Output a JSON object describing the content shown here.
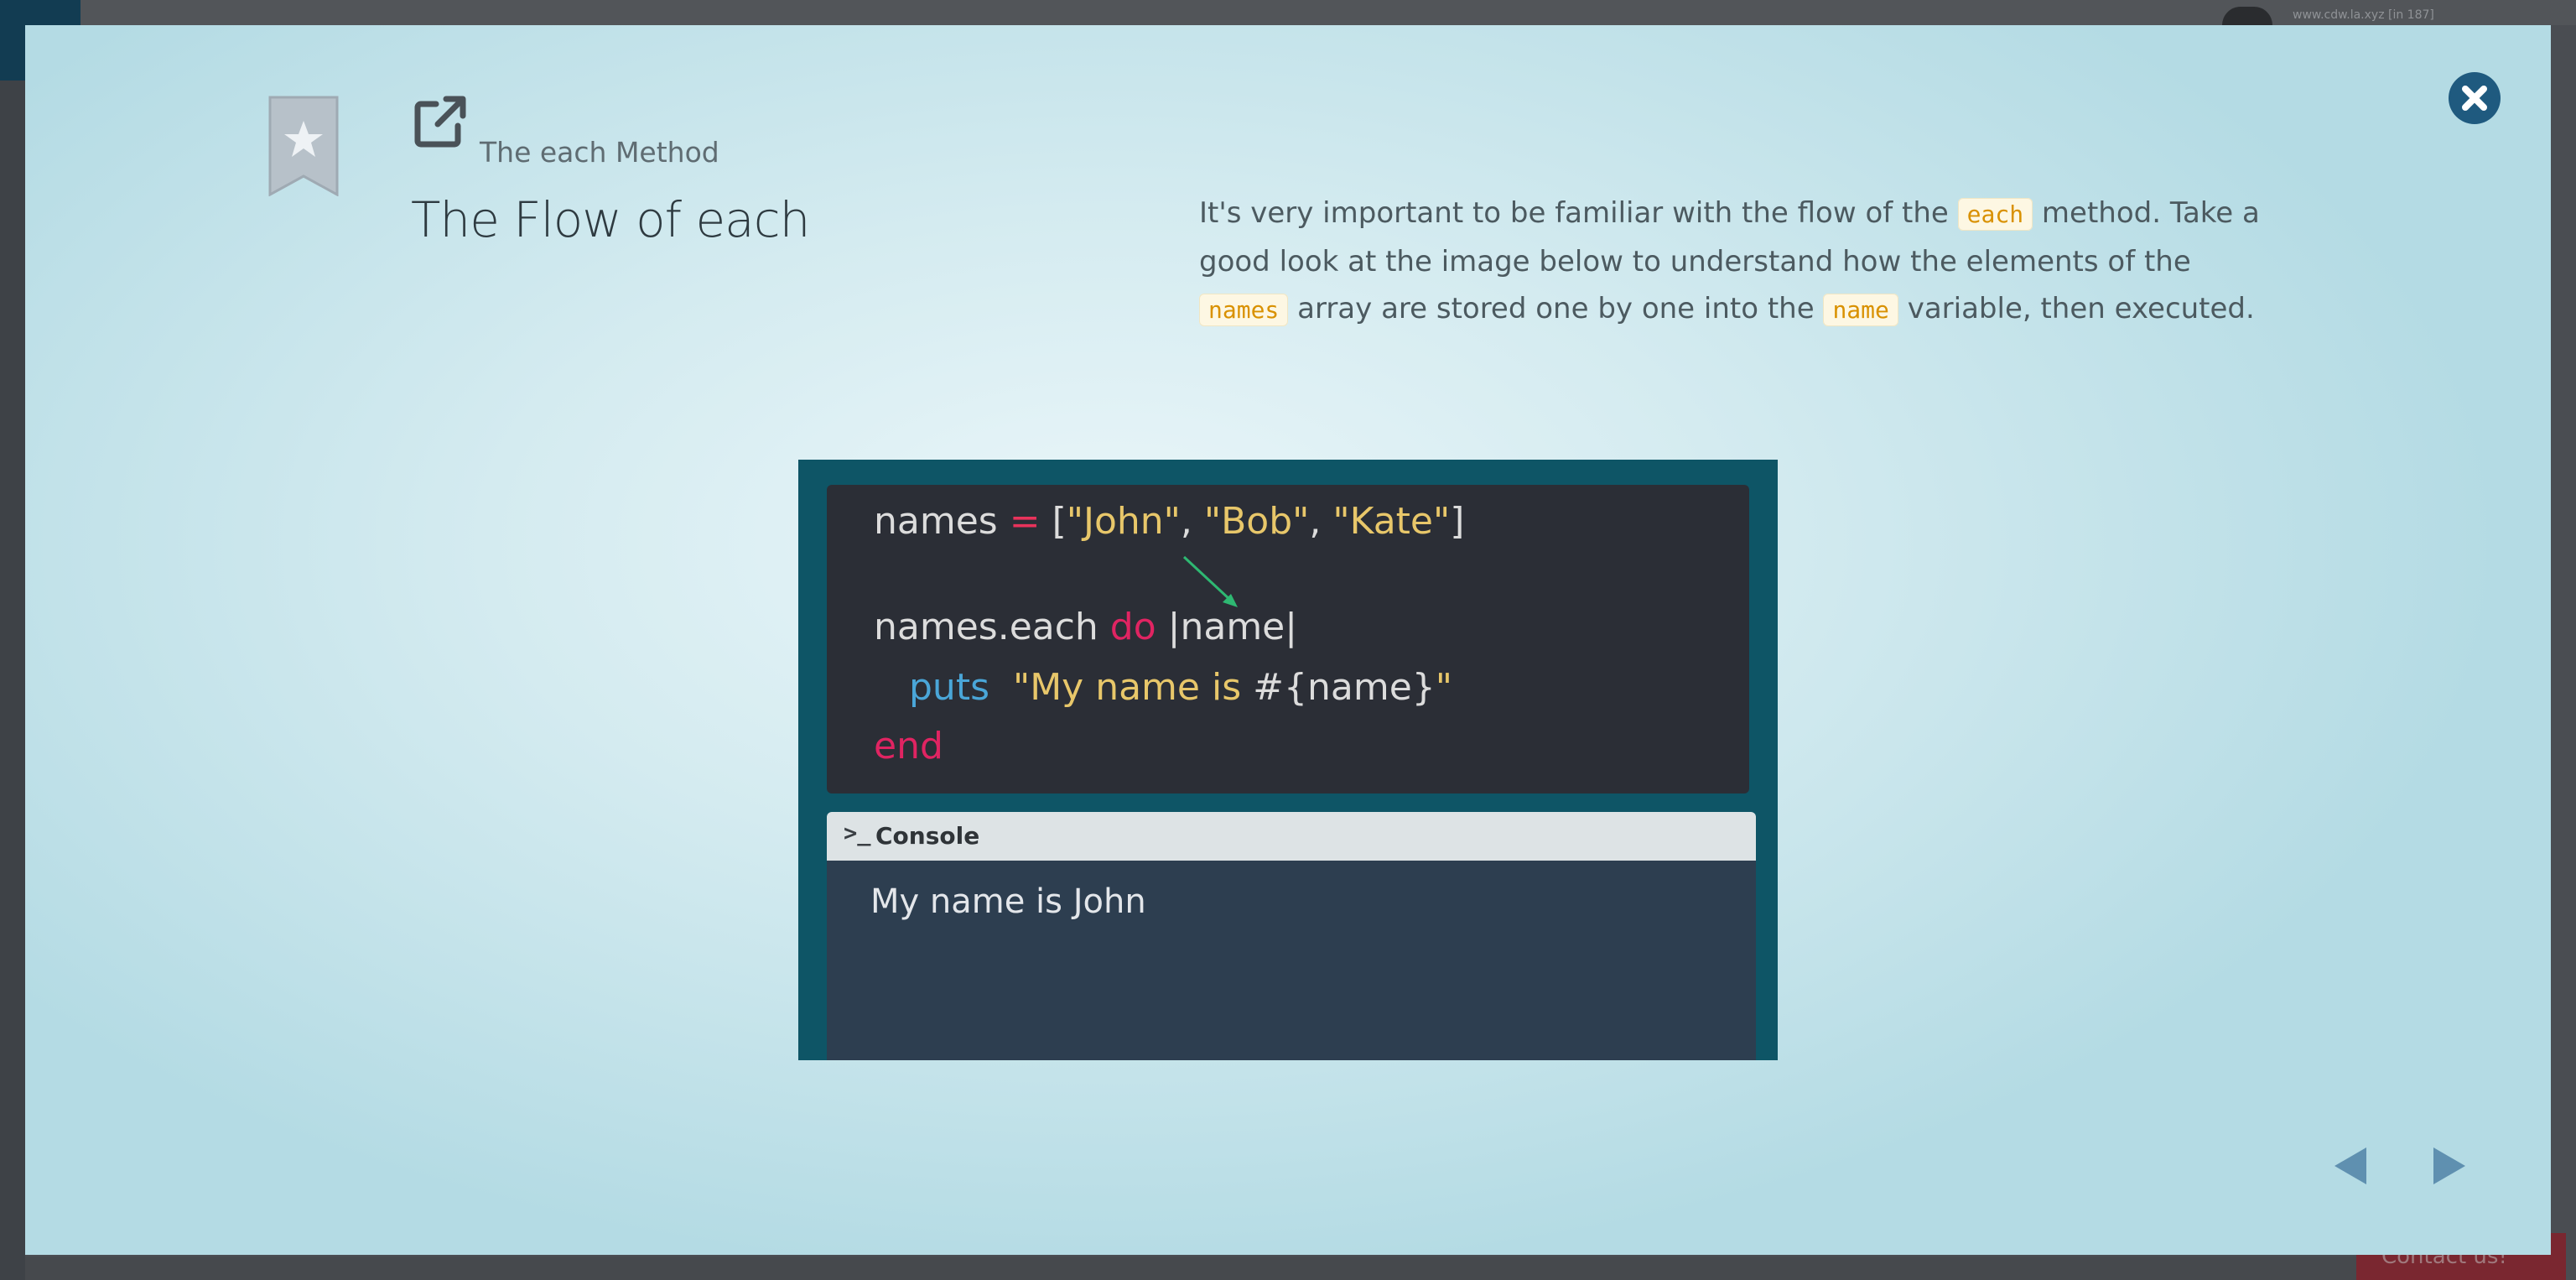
{
  "background": {
    "url_text": "www.cdw.la.xyz [in 187]",
    "contact_label": "Contact us!"
  },
  "modal": {
    "subtitle": "The each Method",
    "title": "The Flow of each",
    "paragraph": {
      "part1": "It's very important to be familiar with the flow of the ",
      "code1": "each",
      "part2": " method. Take a good look at the image below to understand how the elements of the ",
      "code2": "names",
      "part3": " array are stored one by one into the ",
      "code3": "name",
      "part4": " variable, then executed."
    },
    "code": {
      "l1_var": "names ",
      "l1_op": "=",
      "l1_open": " [",
      "l1_s1": "\"John\"",
      "l1_c1": ", ",
      "l1_s2": "\"Bob\"",
      "l1_c2": ", ",
      "l1_s3": "\"Kate\"",
      "l1_close": "]",
      "l2_call": "names.each ",
      "l2_kw": "do",
      "l2_param": " |name|",
      "l3_fn": "puts",
      "l3_str1": "\"My name is ",
      "l3_interp": "#{name}",
      "l3_str2": "\"",
      "l4_kw": "end"
    },
    "console": {
      "prompt": ">_",
      "label": "Console",
      "output": "My name is John"
    }
  },
  "colors": {
    "modal_accent": "#1f5a7f",
    "code_bg": "#2b2e36",
    "console_bg": "#2d3e50",
    "inline_code": "#d99100"
  },
  "icons": [
    "bookmark-star-icon",
    "external-link-icon",
    "close-icon",
    "arrow-left-icon",
    "arrow-right-icon",
    "pointer-arrow-icon"
  ]
}
